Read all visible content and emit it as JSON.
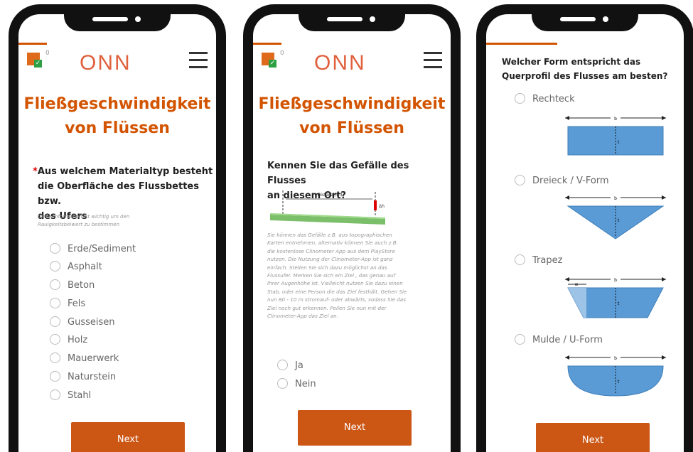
{
  "brand": {
    "logo": "ONN",
    "count": "0"
  },
  "screen1": {
    "title_line1": "Fließgeschwindigkeit",
    "title_line2": "von Flüssen",
    "required_mark": "*",
    "question_line1": "Aus welchem Materialtyp besteht",
    "question_line2": "die Oberfläche des Flussbettes bzw.",
    "question_line3": "des Ufers",
    "hint_line1": "Diese Information ist wichtig um den",
    "hint_line2": "Rauigkeitsbeiwert zu bestimmen",
    "options": [
      "Erde/Sediment",
      "Asphalt",
      "Beton",
      "Fels",
      "Gusseisen",
      "Holz",
      "Mauerwerk",
      "Naturstein",
      "Stahl"
    ],
    "next_label": "Next"
  },
  "screen2": {
    "title_line1": "Fließgeschwindigkeit",
    "title_line2": "von Flüssen",
    "question_line1": "Kennen Sie das Gefälle des Flusses",
    "question_line2": "an diesem Ort?",
    "diagram_label": "Distanz (m)",
    "diagram_h_label": "Δh",
    "text_lines": [
      "Sie können das Gefälle z.B. aus topographischen",
      "Karten entnehmen, alternativ können Sie auch z.B.",
      "die kostenlose Clinometer App aus dem PlayStore",
      "nutzen. Die Nutzung der Clinometer-App ist ganz",
      "einfach. Stellen Sie sich dazu möglichst an das",
      "Flussufer. Merken Sie sich ein Ziel , das genau auf",
      "Ihrer Augenhöhe ist. Vielleicht nutzen Sie dazu einen",
      "Stab, oder eine Person die das Ziel festhält. Gehen Sie",
      "nun 80 - 10 m stromauf- oder abwärts, sodass Sie das",
      "Ziel noch gut erkennen. Peilen Sie nun mit der",
      "Clinometer-App das Ziel an."
    ],
    "options": [
      "Ja",
      "Nein"
    ],
    "next_label": "Next"
  },
  "screen3": {
    "question_line1": "Welcher Form entspricht das",
    "question_line2": "Querprofil des Flusses am besten?",
    "options": [
      "Rechteck",
      "Dreieck / V-Form",
      "Trapez",
      "Mulde / U-Form"
    ],
    "dim_b": "b",
    "dim_t": "t",
    "dim_w": "w",
    "next_label": "Next"
  },
  "colors": {
    "accent": "#d35400",
    "button": "#cc5614",
    "water": "#5b9bd5",
    "frame": "#111111"
  }
}
